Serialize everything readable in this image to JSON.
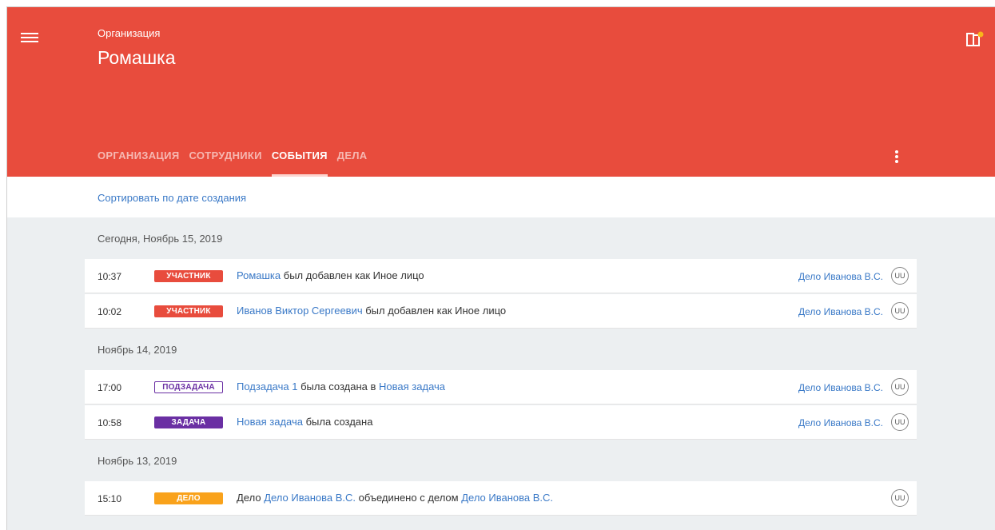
{
  "header": {
    "org_label": "Организация",
    "org_title": "Ромашка",
    "menu_icon": "hamburger-menu-icon",
    "app_icon": "app-switch-icon",
    "kebab_icon": "more-vertical-icon",
    "color": "#e84c3d",
    "tabs": [
      {
        "label": "ОРГАНИЗАЦИЯ",
        "active": false
      },
      {
        "label": "СОТРУДНИКИ",
        "active": false
      },
      {
        "label": "СОБЫТИЯ",
        "active": true
      },
      {
        "label": "ДЕЛА",
        "active": false
      }
    ]
  },
  "sort": {
    "label": "Сортировать по дате создания"
  },
  "groups": [
    {
      "date": "Сегодня, Ноябрь 15, 2019",
      "events": [
        {
          "time": "10:37",
          "badge": "УЧАСТНИК",
          "parts": [
            "Ромашка",
            " был добавлен как Иное лицо"
          ],
          "case": "Дело Иванова В.С.",
          "avatar": "UU"
        },
        {
          "time": "10:02",
          "badge": "УЧАСТНИК",
          "parts": [
            "Иванов Виктор Сергеевич",
            " был добавлен как Иное лицо"
          ],
          "case": "Дело Иванова В.С.",
          "avatar": "UU"
        }
      ]
    },
    {
      "date": "Ноябрь 14, 2019",
      "events": [
        {
          "time": "17:00",
          "badge": "ПОДЗАДАЧА",
          "parts": [
            "Подзадача 1",
            " была создана в ",
            "Новая задача"
          ],
          "case": "Дело Иванова В.С.",
          "avatar": "UU"
        },
        {
          "time": "10:58",
          "badge": "ЗАДАЧА",
          "parts": [
            "Новая задача",
            " была создана"
          ],
          "case": "Дело Иванова В.С.",
          "avatar": "UU"
        }
      ]
    },
    {
      "date": "Ноябрь 13, 2019",
      "events": [
        {
          "time": "15:10",
          "badge": "ДЕЛО",
          "parts": [
            "Дело ",
            "Дело Иванова В.С.",
            " объединено с делом ",
            "Дело Иванова В.С."
          ],
          "case": "",
          "avatar": "UU"
        }
      ]
    }
  ]
}
